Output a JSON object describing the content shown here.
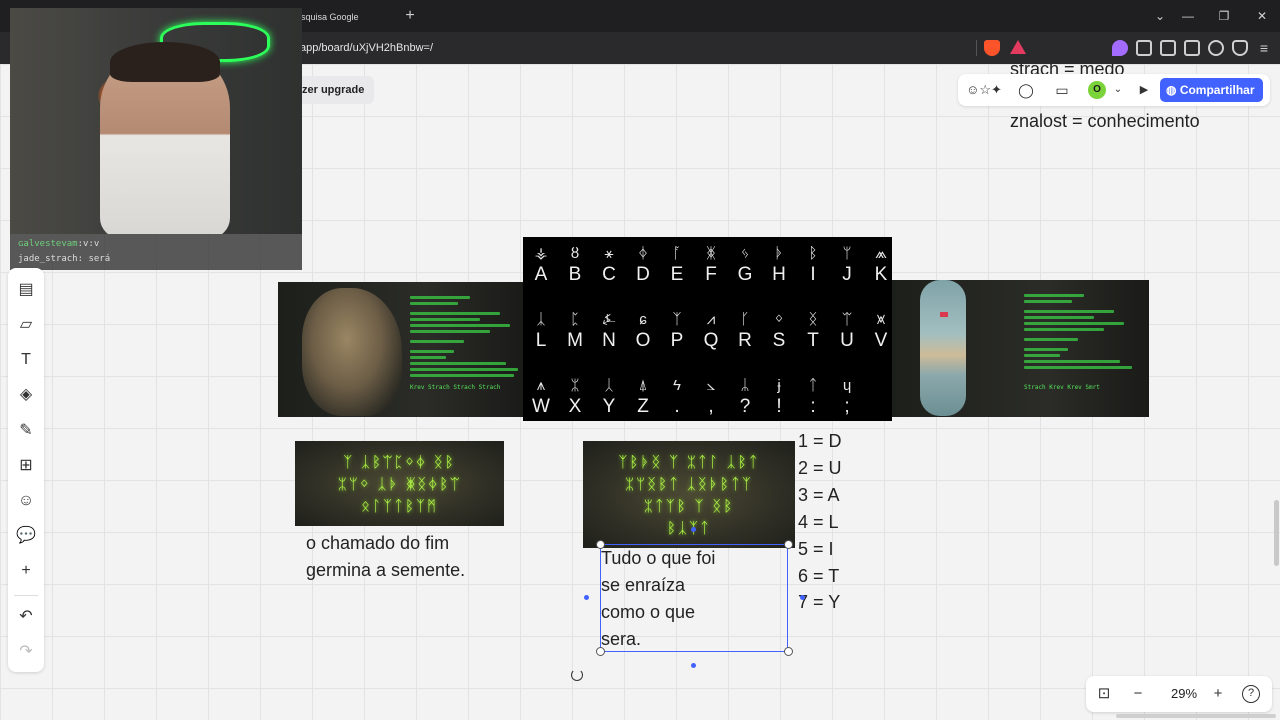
{
  "browser": {
    "tab_title": "esquisa Google",
    "new_tab": "+",
    "url": "app/board/uXjVH2hBnbw=/",
    "window_controls": [
      "⌄",
      "—",
      "❐",
      "✕"
    ]
  },
  "board": {
    "upgrade_label": "zer upgrade",
    "share_label": "Compartilhar",
    "avatar_initial": "O",
    "zoom": "29%",
    "notes": {
      "top_cut": "strach = medo",
      "znalost": "znalost = conhecimento",
      "phrase_left": [
        "o chamado do fim",
        "germina a semente."
      ],
      "phrase_selected": [
        "Tudo o que foi",
        "se enraíza",
        "como o que",
        "sera."
      ],
      "mapping": [
        "1 = D",
        "2 = U",
        "3 = A",
        "4 = L",
        "5 = I",
        "6 = T",
        "7 = Y"
      ]
    },
    "alphabet": {
      "rows": [
        {
          "glyphs": [
            "⚶",
            "ȣ",
            "⚹",
            "ᛄ",
            "ᚪ",
            "ᛤ",
            "ᛃ",
            "ᚧ",
            "ᛒ",
            "ᛘ",
            "⩕"
          ],
          "letters": [
            "A",
            "B",
            "C",
            "D",
            "E",
            "F",
            "G",
            "H",
            "I",
            "J",
            "K"
          ]
        },
        {
          "glyphs": [
            "ᛣ",
            "ᛈ",
            "⍼",
            "ɕ",
            "ᛉ",
            "⩘",
            "ᚴ",
            "ᛜ",
            "ᛝ",
            "ᛠ",
            "⩙"
          ],
          "letters": [
            "L",
            "M",
            "N",
            "O",
            "P",
            "Q",
            "R",
            "S",
            "T",
            "U",
            "V"
          ]
        },
        {
          "glyphs": [
            "⩚",
            "ᛯ",
            "ᛸ",
            "⍋",
            "ϟ",
            "⦣",
            "ᛦ",
            "ɉ",
            "ᛏ",
            "ɥ"
          ],
          "letters": [
            "W",
            "X",
            "Y",
            "Z",
            ".",
            ",",
            "?",
            "!",
            ":",
            ";"
          ]
        }
      ]
    },
    "panels": {
      "left_caption": "Krev Strach Strach Strach",
      "right_caption": "Strach Krev Krev Smrt",
      "rune_left_rows": [
        "ᛉ ᛣᛒᛠᛈᛜᛄ ᛝᛒ",
        "ᛯᛘᛜ ᛣᚧ ᛤᛝᛄᛒᛠ",
        "ᛟᛚᛉᛏᛒᛉᛗ"
      ],
      "rune_right_rows": [
        "ᛉᛒᚧᛝ ᛉ ᛯᛏᛚ ᛣᛒᛏ",
        "ᛯᛘᛝᛒᛏ ᛣᛝᚧᛒᛏᛉ",
        "ᛯᛏᛉᛒ ᛉ ᛝᛒ",
        "ᛒᛣᛉᛏ"
      ]
    },
    "colors": {
      "accent": "#4262ff",
      "neon": "#b7ff4a"
    }
  },
  "stream_chat": {
    "line1_user": "ɢalvestevam",
    "line1_text": ":v:v",
    "line2_user": "jade_strach",
    "line2_text": ": será"
  },
  "left_toolbar": {
    "icons": [
      "templates-icon",
      "sticky-note-icon",
      "text-icon",
      "shapes-icon",
      "pen-icon",
      "frame-icon",
      "sticker-icon",
      "comment-icon",
      "add-icon",
      "undo-icon",
      "redo-icon"
    ],
    "glyphs": [
      "▤",
      "▱",
      "T",
      "◈",
      "✎",
      "⊞",
      "☺",
      "💬",
      "+",
      "↶",
      "↷"
    ]
  }
}
